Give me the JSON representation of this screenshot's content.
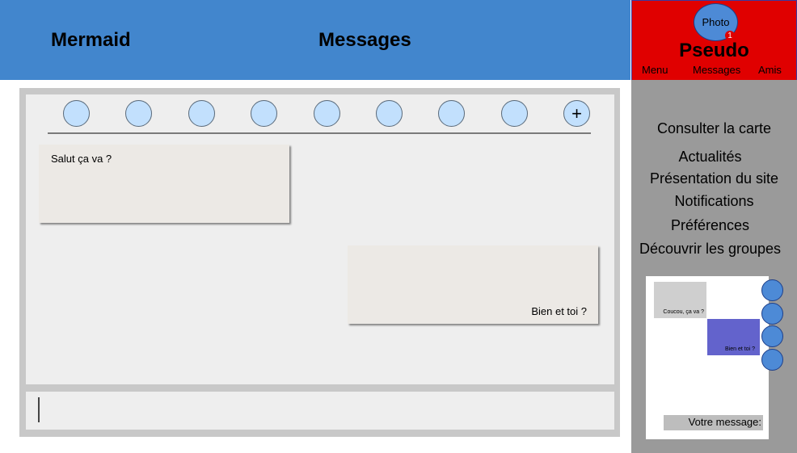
{
  "header": {
    "app_name": "Mermaid",
    "page_title": "Messages"
  },
  "profile": {
    "photo_label": "Photo",
    "notification_count": "1",
    "pseudo": "Pseudo",
    "nav": [
      "Menu",
      "Messages",
      "Amis"
    ]
  },
  "sidebar": {
    "links": [
      "Consulter la carte",
      "Actualités",
      "Présentation du site",
      "Notifications",
      "Préférences",
      "Découvrir les groupes"
    ]
  },
  "mini_chat": {
    "message_1": "Coucou, ça va ?",
    "message_2": "Bien et toi ?",
    "input_label": "Votre message:"
  },
  "chat": {
    "contacts_count": 8,
    "add_symbol": "+",
    "messages": [
      {
        "text": "Salut ça va ?",
        "side": "left"
      },
      {
        "text": "Bien et toi ?",
        "side": "right"
      }
    ]
  },
  "colors": {
    "header": "#4286cd",
    "profile": "#e00000",
    "sidebar": "#9a9a9a",
    "contact_circle": "#c2e0fd",
    "mini_sent": "#6363cc"
  }
}
